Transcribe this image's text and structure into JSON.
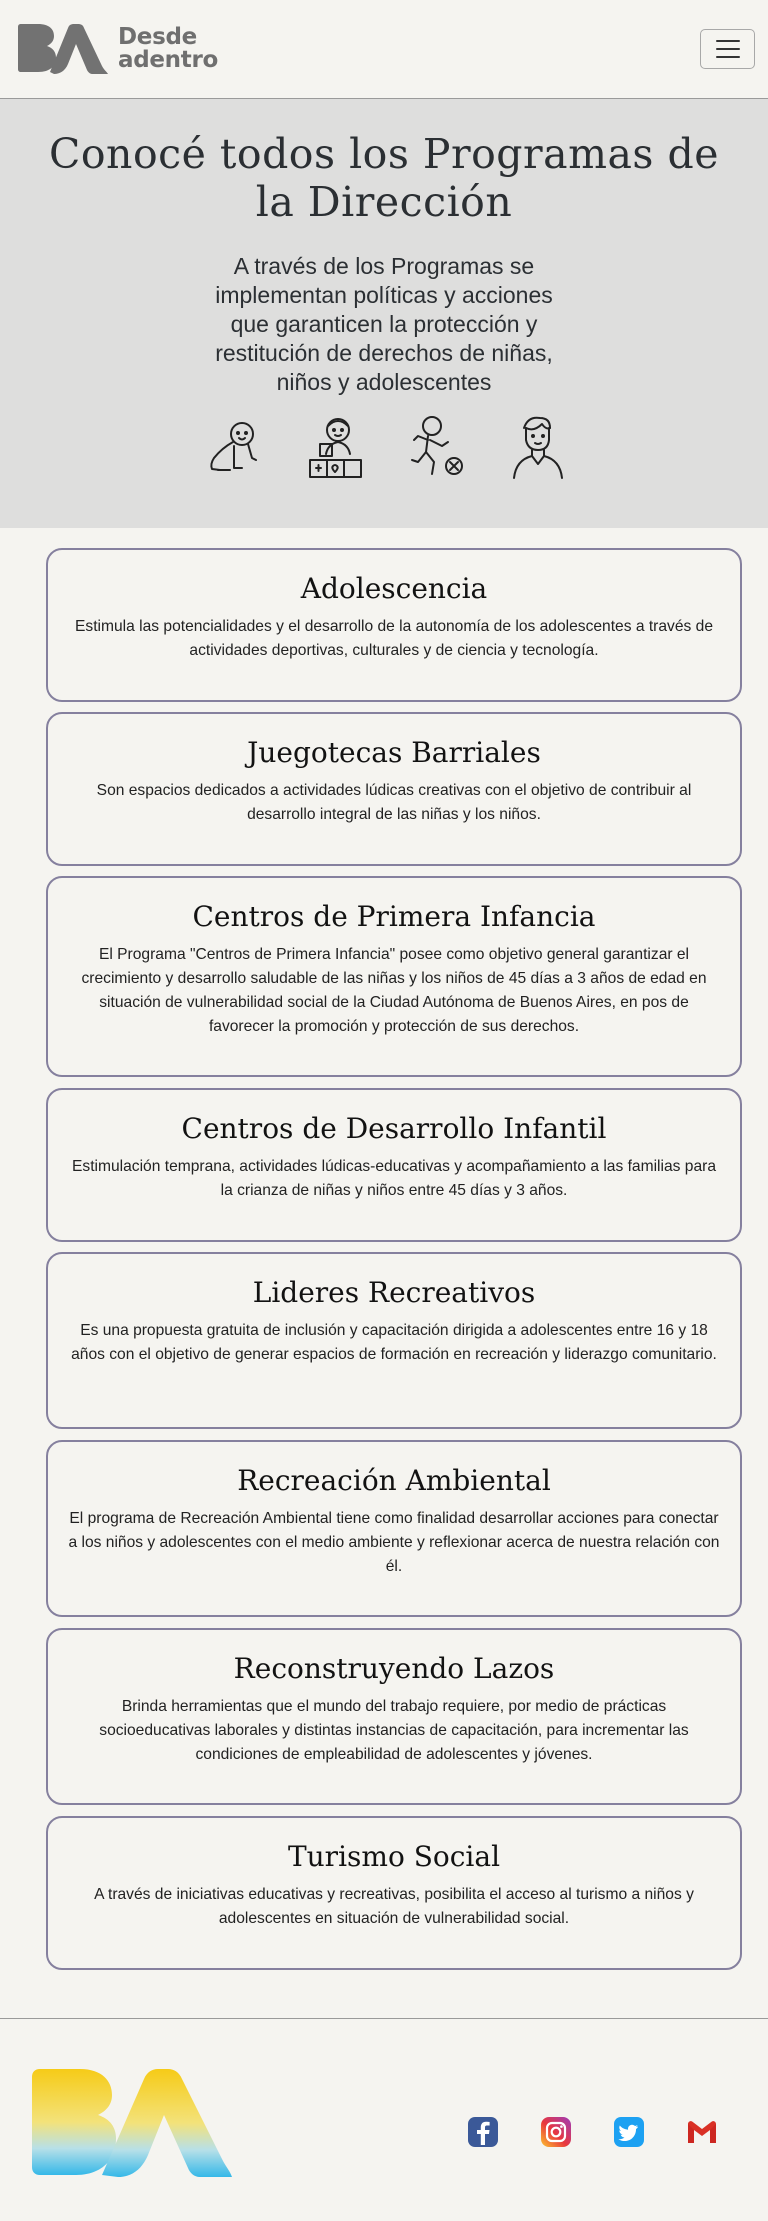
{
  "header": {
    "brand_line1": "Desde",
    "brand_line2": "adentro",
    "menu_icon": "hamburger-icon"
  },
  "hero": {
    "title": "Conocé todos los Programas de la Dirección",
    "subtitle": "A través de los Programas se implementan políticas y acciones que garanticen la protección y restitución de derechos de niñas, niños y adolescentes",
    "icons": [
      "baby-crawling-icon",
      "child-with-blocks-icon",
      "kid-playing-ball-icon",
      "adolescent-icon"
    ]
  },
  "programs": [
    {
      "title": "Adolescencia",
      "description": "Estimula las potencialidades y el desarrollo de la autonomía de los adolescentes a través de actividades deportivas, culturales y de ciencia y tecnología."
    },
    {
      "title": "Juegotecas Barriales",
      "description": "Son espacios dedicados a actividades lúdicas creativas con el objetivo de contribuir al desarrollo integral de las niñas y los niños."
    },
    {
      "title": "Centros de Primera Infancia",
      "description": "El Programa \"Centros de Primera Infancia\" posee como objetivo general garantizar el crecimiento y desarrollo saludable de las niñas y los niños de 45 días a 3 años de edad en situación de vulnerabilidad social de la Ciudad Autónoma de Buenos Aires, en pos de favorecer la promoción y protección de sus derechos."
    },
    {
      "title": "Centros de Desarrollo Infantil",
      "description": "Estimulación temprana, actividades lúdicas-educativas y acompañamiento a las familias para la crianza de niñas y niños entre 45 días y 3 años."
    },
    {
      "title": "Lideres Recreativos",
      "description": "Es una propuesta gratuita de inclusión y capacitación dirigida a adolescentes entre 16 y 18 años con el objetivo de generar espacios de formación en recreación y liderazgo comunitario."
    },
    {
      "title": "Recreación Ambiental",
      "description": "El programa de Recreación Ambiental tiene como finalidad desarrollar acciones para conectar a los niños y adolescentes con el medio ambiente y reflexionar acerca de nuestra relación con él."
    },
    {
      "title": "Reconstruyendo Lazos",
      "description": "Brinda herramientas que el mundo del trabajo requiere, por medio de prácticas socioeducativas laborales y distintas instancias de capacitación, para incrementar las condiciones de empleabilidad de adolescentes y jóvenes."
    },
    {
      "title": "Turismo Social",
      "description": "A través de iniciativas educativas y recreativas, posibilita el acceso al turismo a niños y adolescentes en situación de vulnerabilidad social."
    }
  ],
  "footer": {
    "logo": "BA",
    "social_icons": [
      "facebook-icon",
      "instagram-icon",
      "twitter-icon",
      "gmail-icon"
    ],
    "colors": {
      "facebook": "#3b5998",
      "twitter": "#1da1f2",
      "gmail": "#d93025",
      "logo_top": "#f6cb17",
      "logo_bottom": "#35b8e8"
    }
  }
}
